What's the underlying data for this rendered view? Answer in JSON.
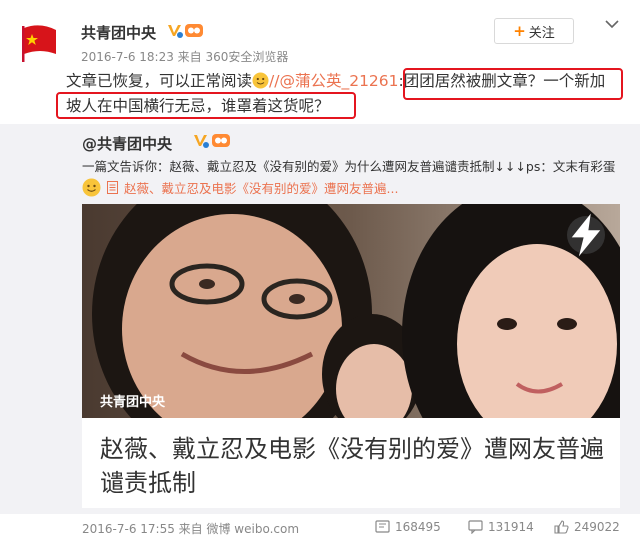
{
  "post": {
    "author": "共青团中央",
    "meta": "2016-7-6 18:23 来自 360安全浏览器",
    "follow_label": "关注",
    "text_prefix": "文章已恢复，可以正常阅读",
    "mention": "//@蒲公英_21261",
    "text_rest_line1": ":团团居然被删文章？一个新加",
    "text_line2": "坡人在中国横行无忌，谁罩着这货呢？"
  },
  "repost": {
    "author": "@共青团中央",
    "text": "一篇文告诉你：赵薇、戴立忍及《没有别的爱》为什么遭网友普遍谴责抵制↓↓↓ps：文末有彩蛋",
    "link_text": "赵薇、戴立忍及电影《没有别的爱》遭网友普遍...",
    "card": {
      "watermark": "共青团中央",
      "title": "赵薇、戴立忍及电影《没有别的爱》遭网友普遍谴责抵制"
    },
    "footer": {
      "meta": "2016-7-6 17:55 来自 微博 weibo.com",
      "reposts": "168495",
      "comments": "131914",
      "likes": "249022"
    }
  },
  "colors": {
    "accent": "#eb7350",
    "highlight_box": "#e4151f",
    "repost_bg": "#f2f2f5"
  },
  "icons": [
    "flag-avatar-icon",
    "verified-v-icon",
    "level-badge-icon",
    "chevron-down-icon",
    "smile-emoji-icon",
    "article-doc-icon",
    "flash-icon",
    "repost-icon",
    "comment-icon",
    "like-icon"
  ]
}
